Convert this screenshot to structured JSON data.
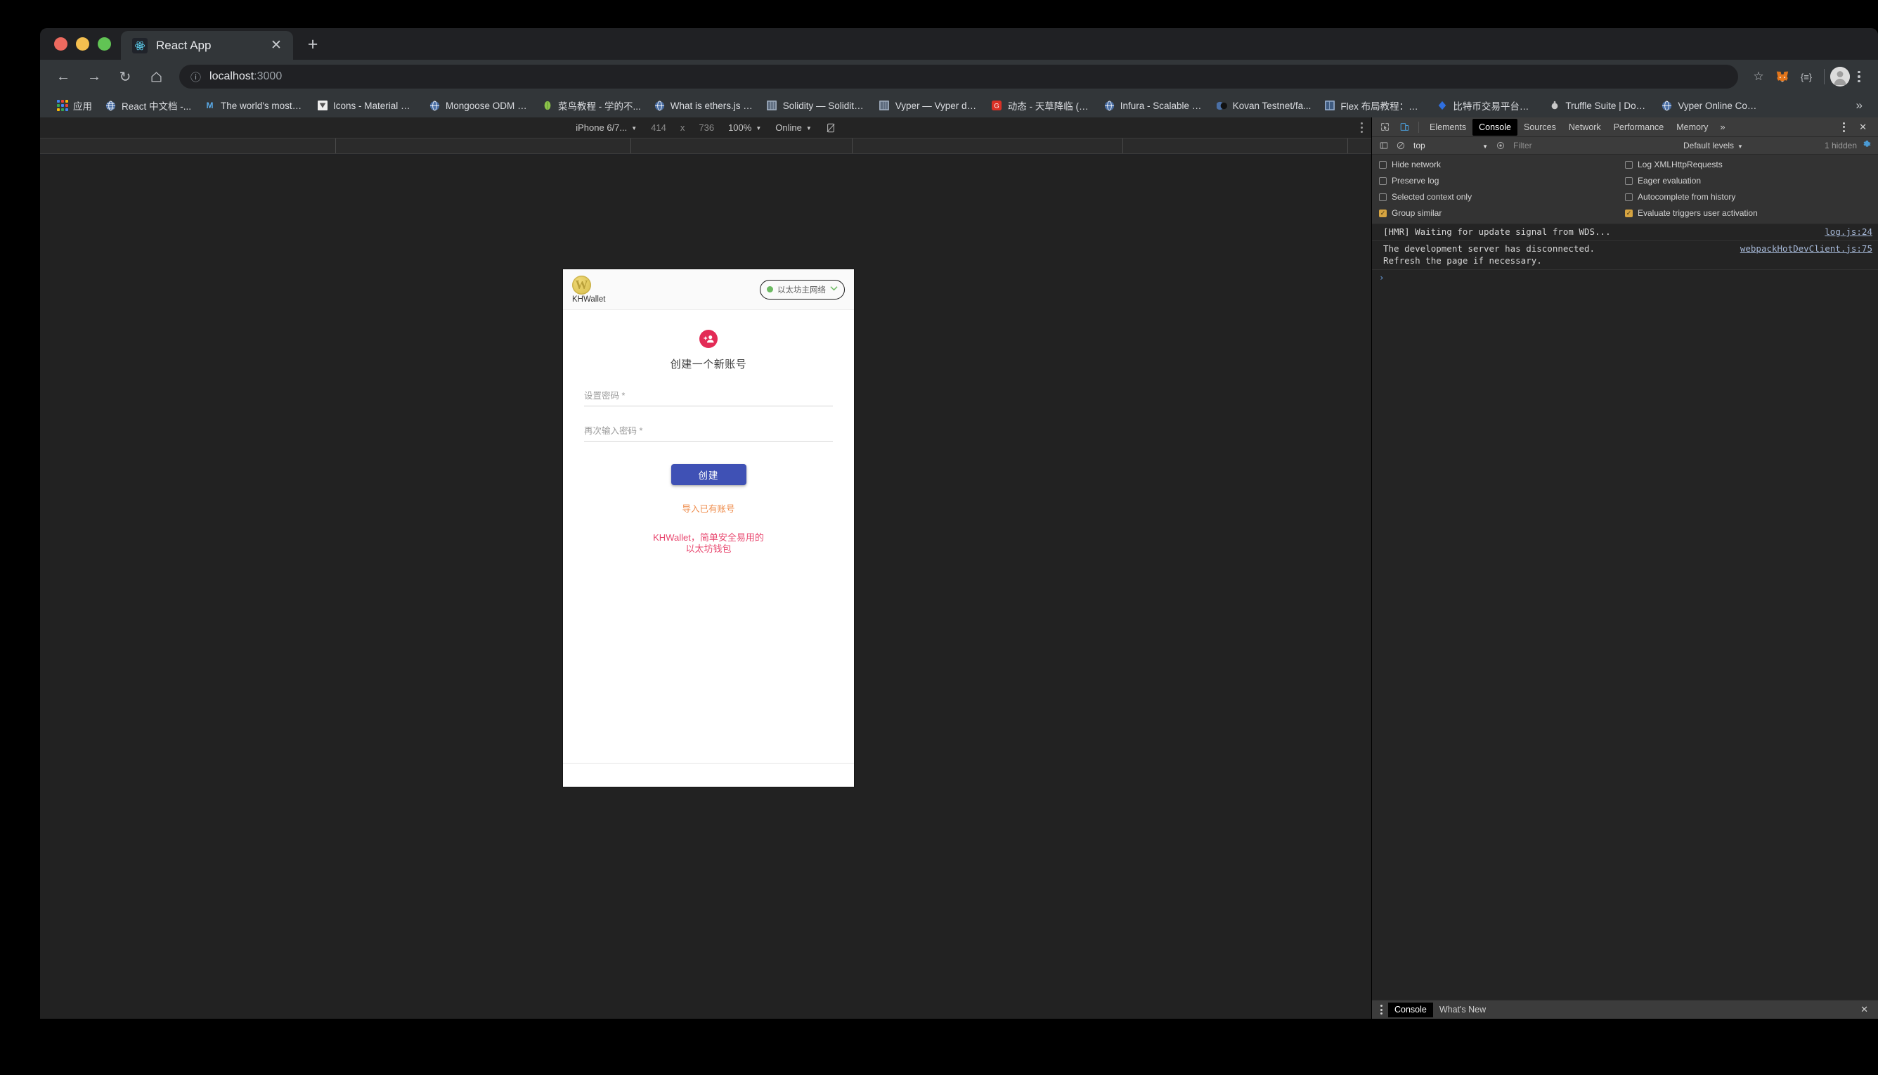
{
  "browser": {
    "tab": {
      "title": "React App",
      "favicon": "react-icon",
      "close_label": "✕"
    },
    "new_tab_label": "+",
    "nav": {
      "back": "←",
      "forward": "→",
      "reload": "↻",
      "home": "⌂"
    },
    "omnibox": {
      "info_icon": "ⓘ",
      "host": "localhost",
      "port": ":3000"
    },
    "toolbar_right": {
      "bookmark_star": "☆",
      "extension_metamask": "metamask-fox-icon",
      "extension_two": "{≡}",
      "menu": "kebab-menu-icon"
    },
    "bookmarks": {
      "apps_label": "应用",
      "overflow": "»",
      "items": [
        {
          "label": "React 中文档 -...",
          "icon": "globe",
          "color": "#4a6fa5"
        },
        {
          "label": "The world's most p...",
          "icon": "mj",
          "color": "#5aa9e6"
        },
        {
          "label": "Icons - Material De...",
          "icon": "material",
          "color": "#e8e8e8"
        },
        {
          "label": "Mongoose ODM v5...",
          "icon": "globe",
          "color": "#4a6fa5"
        },
        {
          "label": "菜鸟教程 - 学的不...",
          "icon": "leaf",
          "color": "#8bc34a"
        },
        {
          "label": "What is ethers.js — ...",
          "icon": "globe",
          "color": "#4a6fa5"
        },
        {
          "label": "Solidity — Solidity...",
          "icon": "docs",
          "color": "#7d8fa8"
        },
        {
          "label": "Vyper — Vyper doc...",
          "icon": "docs",
          "color": "#7d8fa8"
        },
        {
          "label": "动态 - 天草降临 (Ti...",
          "icon": "g",
          "color": "#d93025"
        },
        {
          "label": "Infura - Scalable Bl...",
          "icon": "globe",
          "color": "#4a6fa5"
        },
        {
          "label": "Kovan Testnet/fa...",
          "icon": "globe-dark",
          "color": "#4a6fa5"
        },
        {
          "label": "Flex 布局教程：语...",
          "icon": "docs",
          "color": "#5b7fb5"
        },
        {
          "label": "比特币交易平台OK...",
          "icon": "okex",
          "color": "#2f6fe0"
        },
        {
          "label": "Truffle Suite | Docu...",
          "icon": "truffle",
          "color": "#c8c8c8"
        },
        {
          "label": "Vyper Online Comp...",
          "icon": "globe",
          "color": "#4a6fa5"
        }
      ]
    }
  },
  "device_toolbar": {
    "device": "iPhone 6/7...",
    "width": "414",
    "times": "x",
    "height": "736",
    "zoom": "100%",
    "throttling": "Online",
    "rotate_icon": "rotate-icon"
  },
  "app": {
    "brand": {
      "logo_letter": "W",
      "name": "KHWallet"
    },
    "network": {
      "label": "以太坊主网络",
      "status_color": "#6cba62",
      "caret": "⌄"
    },
    "title": "创建一个新账号",
    "avatar_icon": "person-add-icon",
    "fields": [
      {
        "placeholder": "设置密码 *",
        "value": ""
      },
      {
        "placeholder": "再次输入密码 *",
        "value": ""
      }
    ],
    "create_button": "创建",
    "import_link": "导入已有账号",
    "tagline_line1": "KHWallet，简单安全易用的",
    "tagline_line2": "以太坊钱包",
    "colors": {
      "primary": "#3f51b5",
      "accent_pink": "#e8466e",
      "accent_orange": "#ef8c4b",
      "logo_gold": "#e0c85c"
    }
  },
  "devtools": {
    "tabs": [
      "Elements",
      "Console",
      "Sources",
      "Network",
      "Performance",
      "Memory"
    ],
    "selected_tab": "Console",
    "more_tabs": "»",
    "close": "✕",
    "filter_bar": {
      "context": "top",
      "filter_placeholder": "Filter",
      "levels": "Default levels",
      "hidden_count": "1 hidden",
      "settings_icon": "gear-icon",
      "eye_icon": "live-expression-icon",
      "clear_icon": "clear-console-icon",
      "sidebar_icon": "console-sidebar-icon"
    },
    "settings": [
      {
        "label": "Hide network",
        "checked": false
      },
      {
        "label": "Log XMLHttpRequests",
        "checked": false
      },
      {
        "label": "Preserve log",
        "checked": false
      },
      {
        "label": "Eager evaluation",
        "checked": false
      },
      {
        "label": "Selected context only",
        "checked": false
      },
      {
        "label": "Autocomplete from history",
        "checked": false
      },
      {
        "label": "Group similar",
        "checked": true
      },
      {
        "label": "Evaluate triggers user activation",
        "checked": true
      }
    ],
    "logs": [
      {
        "message": "[HMR] Waiting for update signal from WDS...",
        "source": "log.js:24"
      },
      {
        "message": "The development server has disconnected.\nRefresh the page if necessary.",
        "source": "webpackHotDevClient.js:75"
      }
    ],
    "prompt": "›",
    "drawer": {
      "tabs": [
        "Console",
        "What's New"
      ],
      "selected": "Console",
      "close": "✕"
    }
  }
}
